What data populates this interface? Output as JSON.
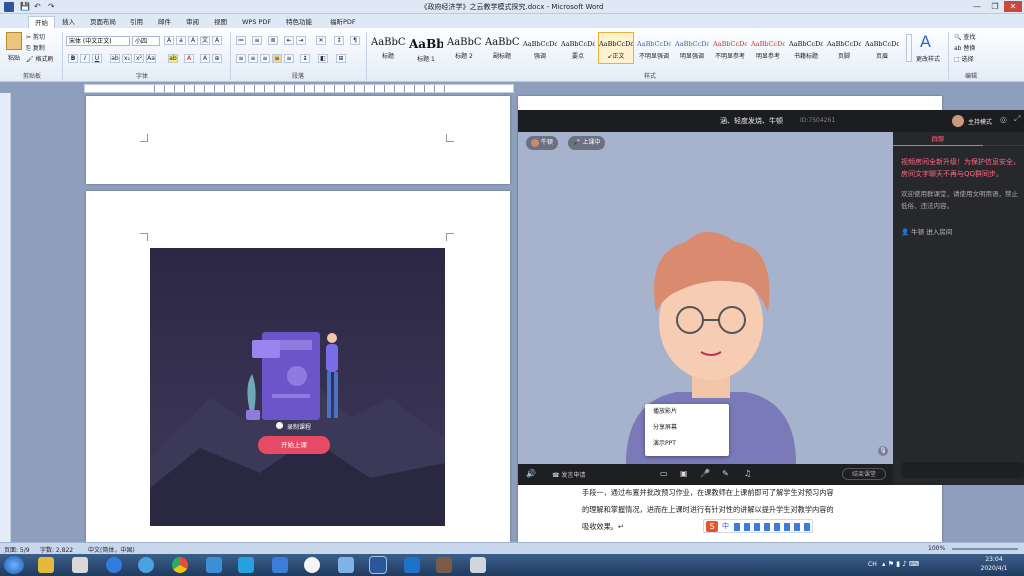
{
  "window": {
    "title": "《政府经济学》之云教学模式探究.docx - Microsoft Word",
    "minimize": "—",
    "restore": "❐",
    "close": "✕"
  },
  "ribbon_tabs": [
    "开始",
    "插入",
    "页面布局",
    "引用",
    "邮件",
    "审阅",
    "视图",
    "WPS PDF",
    "特色功能",
    "福昕PDF"
  ],
  "clipboard": {
    "paste": "粘贴",
    "cut": "剪切",
    "copy": "复制",
    "format_painter": "格式刷",
    "group": "剪贴板"
  },
  "font": {
    "name": "宋体 (中文正文)",
    "size": "小四",
    "group": "字体"
  },
  "paragraph": {
    "group": "段落"
  },
  "styles": {
    "group": "样式",
    "items": [
      {
        "preview": "AaBbC",
        "name": "标题"
      },
      {
        "preview": "AaBb",
        "name": "标题 1"
      },
      {
        "preview": "AaBbC",
        "name": "标题 2"
      },
      {
        "preview": "AaBbC",
        "name": "副标题"
      },
      {
        "preview": "AaBbCcDd",
        "name": "强调"
      },
      {
        "preview": "AaBbCcDd",
        "name": "要点"
      },
      {
        "preview": "AaBbCcDd",
        "name": "↙正文"
      },
      {
        "preview": "AaBbCcDd",
        "name": "不明显强调"
      },
      {
        "preview": "AaBbCcDd",
        "name": "明显强调"
      },
      {
        "preview": "AaBbCcDd",
        "name": "不明显参考"
      },
      {
        "preview": "AaBbCcDd",
        "name": "明显参考"
      },
      {
        "preview": "AaBbCcDd",
        "name": "书籍标题"
      },
      {
        "preview": "AaBbCcDdE",
        "name": "页脚"
      },
      {
        "preview": "AaBbCcDdE",
        "name": "页眉"
      }
    ],
    "change_styles": "更改样式"
  },
  "editing": {
    "find": "查找",
    "replace": "替换",
    "select": "选择",
    "group": "编辑"
  },
  "illustration": {
    "record_option": "录制课程",
    "start_button": "开始上课"
  },
  "video": {
    "title": "涵、轻度发烧、牛顿",
    "room_id": "ID:7504261",
    "host_mode": "主持模式",
    "user_tag": "牛顿",
    "status_tag": "上课中",
    "chat_tab": "群聊",
    "chat_notice": "视频房间全新升级！为保护信息安全，房间文字聊天不再与QQ群同步。",
    "chat_rules": "欢迎使用群课堂，请使用文明用语，禁止低俗、违法内容。",
    "chat_join": "牛顿 进入房间",
    "bottom": {
      "apply_speak": "发言申请",
      "end_class": "结束课堂"
    },
    "menu": [
      "播放影片",
      "分享屏幕",
      "演示PPT"
    ]
  },
  "document_text": {
    "line1": "手段一，通过布置并批改预习作业，在课教师在上课前即可了解学生对预习内容",
    "line2": "的理解和掌握情况，进而在上课时进行有针对性的讲解以提升学生对教学内容的",
    "line3": "吸收效果。↵"
  },
  "statusbar": {
    "page": "页面: 5/9",
    "words": "字数: 2,822",
    "language": "中文(简体，中国)",
    "zoom": "100%"
  },
  "ime": {
    "label": "中"
  },
  "taskbar": {
    "time": "23:04",
    "date": "2020/4/1",
    "lang": "CH"
  }
}
